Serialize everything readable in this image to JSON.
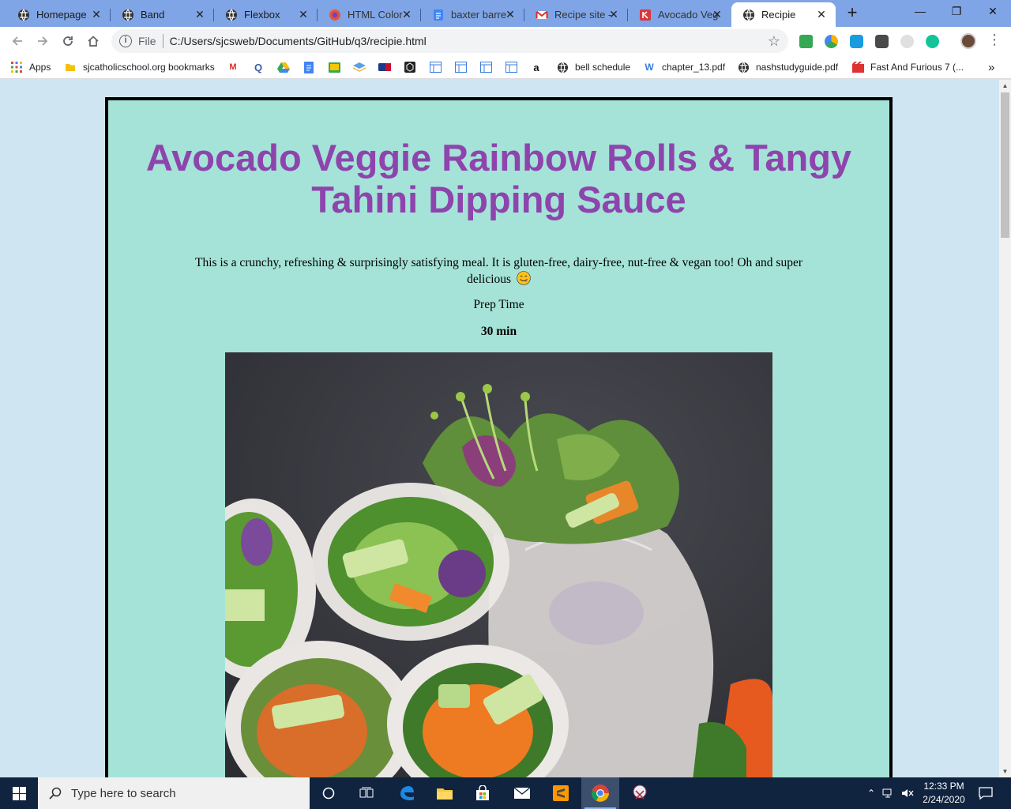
{
  "browser": {
    "tabs": [
      {
        "title": "Homepage",
        "icon": "globe-icon",
        "active": false
      },
      {
        "title": "Band",
        "icon": "globe-icon",
        "active": false
      },
      {
        "title": "Flexbox",
        "icon": "globe-icon",
        "active": false
      },
      {
        "title": "HTML Color",
        "icon": "firefox-like-icon",
        "active": false
      },
      {
        "title": "baxter barre",
        "icon": "docs-icon",
        "active": false
      },
      {
        "title": "Recipe site -",
        "icon": "gmail-icon",
        "active": false
      },
      {
        "title": "Avocado Veg",
        "icon": "recipe-site-icon",
        "active": false
      },
      {
        "title": "Recipie",
        "icon": "globe-icon",
        "active": true
      }
    ],
    "new_tab_label": "+",
    "window_controls": {
      "minimize": "—",
      "restore": "❐",
      "close": "✕"
    },
    "address": {
      "scheme_label": "File",
      "url": "C:/Users/sjcsweb/Documents/GitHub/q3/recipie.html"
    },
    "bookmarks": [
      {
        "label": "Apps",
        "icon": "apps-grid-icon"
      },
      {
        "label": "sjcatholicschool.org bookmarks",
        "icon": "folder-icon"
      },
      {
        "label": "bell schedule",
        "icon": "globe-icon"
      },
      {
        "label": "chapter_13.pdf",
        "icon": "wordpress-icon"
      },
      {
        "label": "nashstudyguide.pdf",
        "icon": "globe-icon"
      },
      {
        "label": "Fast And Furious 7 (...",
        "icon": "movie-icon"
      }
    ],
    "bookmarks_overflow": "»"
  },
  "recipe": {
    "title": "Avocado Veggie Rainbow Rolls & Tangy Tahini Dipping Sauce",
    "description": "This is a crunchy, refreshing & surprisingly satisfying meal. It is gluten-free, dairy-free, nut-free & vegan too! Oh and super delicious",
    "emoji": "😋",
    "prep_label": "Prep Time",
    "prep_value": "30 min",
    "photo": "veggie-rainbow-rolls-photo"
  },
  "colors": {
    "tab_strip": "#7fa5e6",
    "page_background": "#cfe6f2",
    "card_background": "#a5e3d8",
    "title_color": "#8e44ad",
    "taskbar": "#10233f"
  },
  "taskbar": {
    "search_placeholder": "Type here to search",
    "time": "12:33 PM",
    "date": "2/24/2020"
  }
}
